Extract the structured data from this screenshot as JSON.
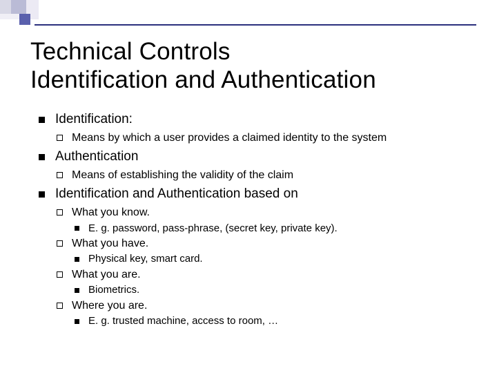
{
  "title": {
    "line1": "Technical Controls",
    "line2": "Identification and Authentication"
  },
  "items": [
    {
      "text": "Identification:",
      "sub": [
        {
          "text": "Means by which a user provides a claimed identity to the system"
        }
      ]
    },
    {
      "text": "Authentication",
      "sub": [
        {
          "text": "Means of establishing the validity of the claim"
        }
      ]
    },
    {
      "text": "Identification and Authentication based on",
      "sub": [
        {
          "text": "What you know.",
          "sub": [
            {
              "text": "E. g. password, pass-phrase, (secret key, private key)."
            }
          ]
        },
        {
          "text": "What you have.",
          "sub": [
            {
              "text": "Physical key, smart card."
            }
          ]
        },
        {
          "text": "What you are.",
          "sub": [
            {
              "text": "Biometrics."
            }
          ]
        },
        {
          "text": "Where you are.",
          "sub": [
            {
              "text": "E. g. trusted machine, access to room, …"
            }
          ]
        }
      ]
    }
  ]
}
